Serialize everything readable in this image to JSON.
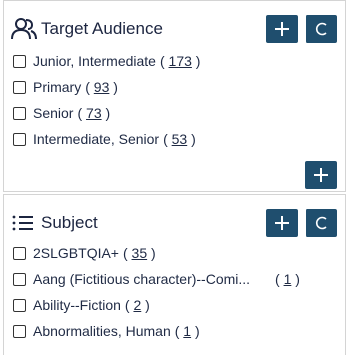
{
  "target_audience": {
    "title": "Target Audience",
    "icon": "users-icon",
    "add_button_icon": "plus-icon",
    "clear_button_icon": "c-icon",
    "more_button_icon": "plus-icon",
    "items": [
      {
        "label": "Junior, Intermediate",
        "count": "173"
      },
      {
        "label": "Primary",
        "count": "93"
      },
      {
        "label": "Senior",
        "count": "73"
      },
      {
        "label": "Intermediate, Senior",
        "count": "53"
      }
    ]
  },
  "subject": {
    "title": "Subject",
    "icon": "list-icon",
    "add_button_icon": "plus-icon",
    "clear_button_icon": "c-icon",
    "items": [
      {
        "label": "2SLGBTQIA+",
        "count": "35"
      },
      {
        "label": "Aang (Fictitious character)--Comi...",
        "count": "1"
      },
      {
        "label": "Ability--Fiction",
        "count": "2"
      },
      {
        "label": "Abnormalities, Human",
        "count": "1"
      }
    ]
  },
  "colors": {
    "button_bg": "#1f4e6e",
    "text": "#1f2a44",
    "border": "#d4d4d4"
  }
}
